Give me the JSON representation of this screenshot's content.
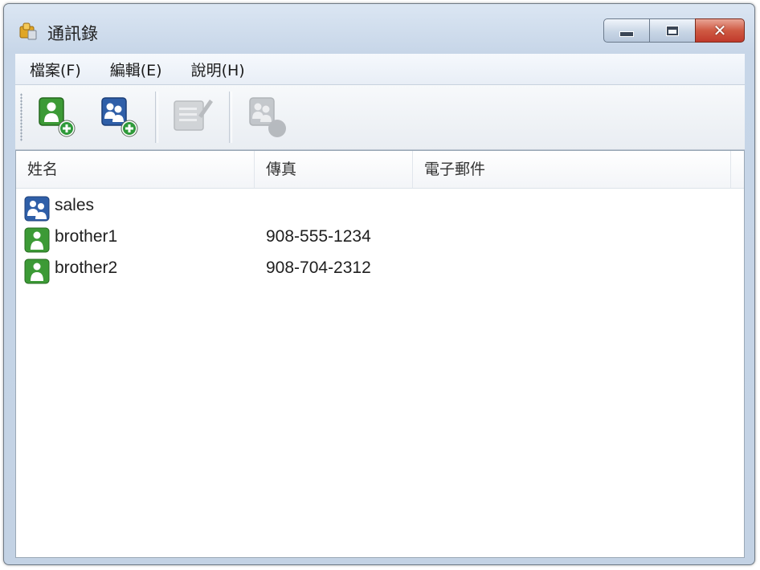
{
  "window": {
    "title": "通訊錄"
  },
  "menubar": {
    "items": [
      {
        "label": "檔案(F)"
      },
      {
        "label": "編輯(E)"
      },
      {
        "label": "說明(H)"
      }
    ]
  },
  "toolbar": {
    "buttons": [
      {
        "icon": "add-contact-icon",
        "enabled": true
      },
      {
        "icon": "add-group-icon",
        "enabled": true
      },
      {
        "icon": "edit-icon",
        "enabled": false
      },
      {
        "icon": "delete-icon",
        "enabled": false
      }
    ]
  },
  "list": {
    "columns": [
      {
        "label": "姓名"
      },
      {
        "label": "傳真"
      },
      {
        "label": "電子郵件"
      }
    ],
    "rows": [
      {
        "type": "group",
        "icon": "group-icon",
        "name": "sales",
        "fax": "",
        "email": ""
      },
      {
        "type": "contact",
        "icon": "contact-icon",
        "name": "brother1",
        "fax": "908-555-1234",
        "email": ""
      },
      {
        "type": "contact",
        "icon": "contact-icon",
        "name": "brother2",
        "fax": "908-704-2312",
        "email": ""
      }
    ]
  },
  "colors": {
    "contact_green": "#3c9a36",
    "group_blue": "#2f5fa8",
    "close_red": "#c9432f"
  }
}
